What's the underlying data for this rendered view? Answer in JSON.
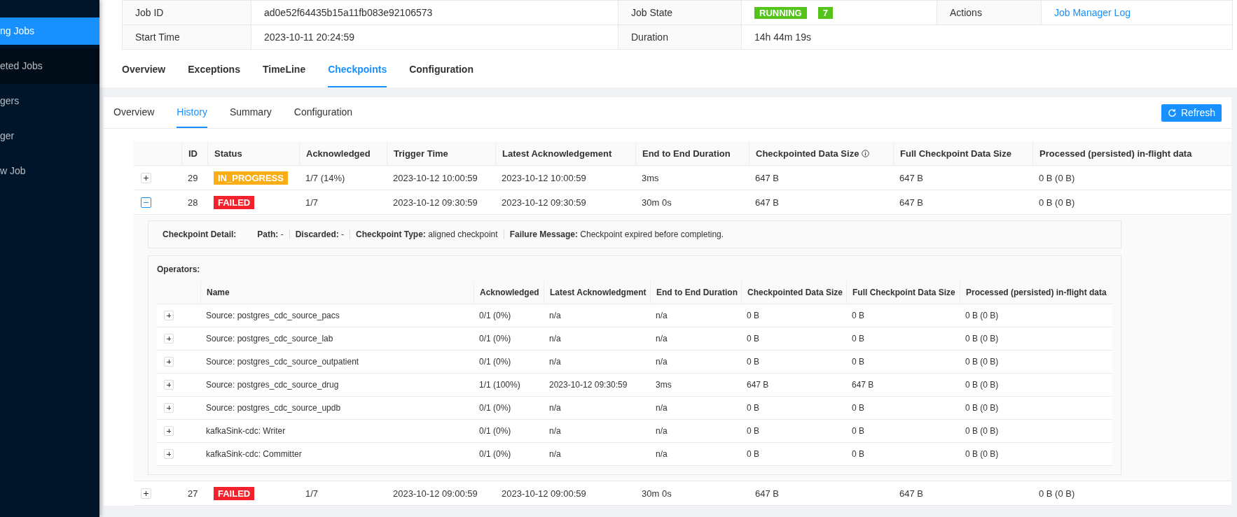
{
  "sidebar": {
    "items": [
      {
        "label": "ng Jobs",
        "selected": true
      },
      {
        "label": "eted Jobs",
        "selected": false
      },
      {
        "label": "gers",
        "selected": false
      },
      {
        "label": "ger",
        "selected": false
      },
      {
        "label": "w Job",
        "selected": false
      }
    ]
  },
  "job_info": {
    "rows": [
      [
        {
          "label": "Job ID",
          "value": "ad0e52f64435b15a11fb083e92106573"
        },
        {
          "label": "Job State",
          "state": "RUNNING",
          "count": "7"
        },
        {
          "label": "Actions",
          "link": "Job Manager Log"
        }
      ],
      [
        {
          "label": "Start Time",
          "value": "2023-10-11 20:24:59"
        },
        {
          "label": "Duration",
          "value": "14h 44m 19s"
        }
      ]
    ]
  },
  "tabs": [
    {
      "label": "Overview",
      "selected": false
    },
    {
      "label": "Exceptions",
      "selected": false
    },
    {
      "label": "TimeLine",
      "selected": false
    },
    {
      "label": "Checkpoints",
      "selected": true
    },
    {
      "label": "Configuration",
      "selected": false
    }
  ],
  "sub_tabs": [
    {
      "label": "Overview",
      "selected": false
    },
    {
      "label": "History",
      "selected": true
    },
    {
      "label": "Summary",
      "selected": false
    },
    {
      "label": "Configuration",
      "selected": false
    }
  ],
  "refresh_button": "Refresh",
  "history": {
    "columns": [
      "ID",
      "Status",
      "Acknowledged",
      "Trigger Time",
      "Latest Acknowledgement",
      "End to End Duration",
      "Checkpointed Data Size",
      "Full Checkpoint Data Size",
      "Processed (persisted) in-flight data"
    ],
    "rows": [
      {
        "expanded": false,
        "id": "29",
        "status": "IN_PROGRESS",
        "color": "#faad14",
        "acknowledged": "1/7 (14%)",
        "trigger_time": "2023-10-12 10:00:59",
        "latest_ack": "2023-10-12 10:00:59",
        "duration": "3ms",
        "data_size": "647 B",
        "full_size": "647 B",
        "processed": "0 B (0 B)"
      },
      {
        "expanded": true,
        "id": "28",
        "status": "FAILED",
        "color": "#f5222d",
        "acknowledged": "1/7",
        "trigger_time": "2023-10-12 09:30:59",
        "latest_ack": "2023-10-12 09:30:59",
        "duration": "30m 0s",
        "data_size": "647 B",
        "full_size": "647 B",
        "processed": "0 B (0 B)",
        "detail": {
          "title": "Checkpoint Detail:",
          "items": [
            {
              "label": "Path:",
              "value": "-"
            },
            {
              "label": "Discarded:",
              "value": "-"
            },
            {
              "label": "Checkpoint Type:",
              "value": "aligned checkpoint"
            },
            {
              "label": "Failure Message:",
              "value": "Checkpoint expired before completing."
            }
          ]
        },
        "operators": {
          "title": "Operators:",
          "columns": [
            "Name",
            "Acknowledged",
            "Latest Acknowledgment",
            "End to End Duration",
            "Checkpointed Data Size",
            "Full Checkpoint Data Size",
            "Processed (persisted) in-flight data"
          ],
          "rows": [
            {
              "expanded": false,
              "cells": [
                "Source: postgres_cdc_source_pacs",
                "0/1 (0%)",
                "n/a",
                "n/a",
                "0 B",
                "0 B",
                "0 B (0 B)"
              ]
            },
            {
              "expanded": false,
              "cells": [
                "Source: postgres_cdc_source_lab",
                "0/1 (0%)",
                "n/a",
                "n/a",
                "0 B",
                "0 B",
                "0 B (0 B)"
              ]
            },
            {
              "expanded": false,
              "cells": [
                "Source: postgres_cdc_source_outpatient",
                "0/1 (0%)",
                "n/a",
                "n/a",
                "0 B",
                "0 B",
                "0 B (0 B)"
              ]
            },
            {
              "expanded": false,
              "cells": [
                "Source: postgres_cdc_source_drug",
                "1/1 (100%)",
                "2023-10-12 09:30:59",
                "3ms",
                "647 B",
                "647 B",
                "0 B (0 B)"
              ]
            },
            {
              "expanded": false,
              "cells": [
                "Source: postgres_cdc_source_updb",
                "0/1 (0%)",
                "n/a",
                "n/a",
                "0 B",
                "0 B",
                "0 B (0 B)"
              ]
            },
            {
              "expanded": false,
              "cells": [
                "kafkaSink-cdc: Writer",
                "0/1 (0%)",
                "n/a",
                "n/a",
                "0 B",
                "0 B",
                "0 B (0 B)"
              ]
            },
            {
              "expanded": false,
              "cells": [
                "kafkaSink-cdc: Committer",
                "0/1 (0%)",
                "n/a",
                "n/a",
                "0 B",
                "0 B",
                "0 B (0 B)"
              ]
            }
          ]
        }
      },
      {
        "expanded": false,
        "id": "27",
        "status": "FAILED",
        "color": "#f5222d",
        "acknowledged": "1/7",
        "trigger_time": "2023-10-12 09:00:59",
        "latest_ack": "2023-10-12 09:00:59",
        "duration": "30m 0s",
        "data_size": "647 B",
        "full_size": "647 B",
        "processed": "0 B (0 B)"
      }
    ]
  }
}
